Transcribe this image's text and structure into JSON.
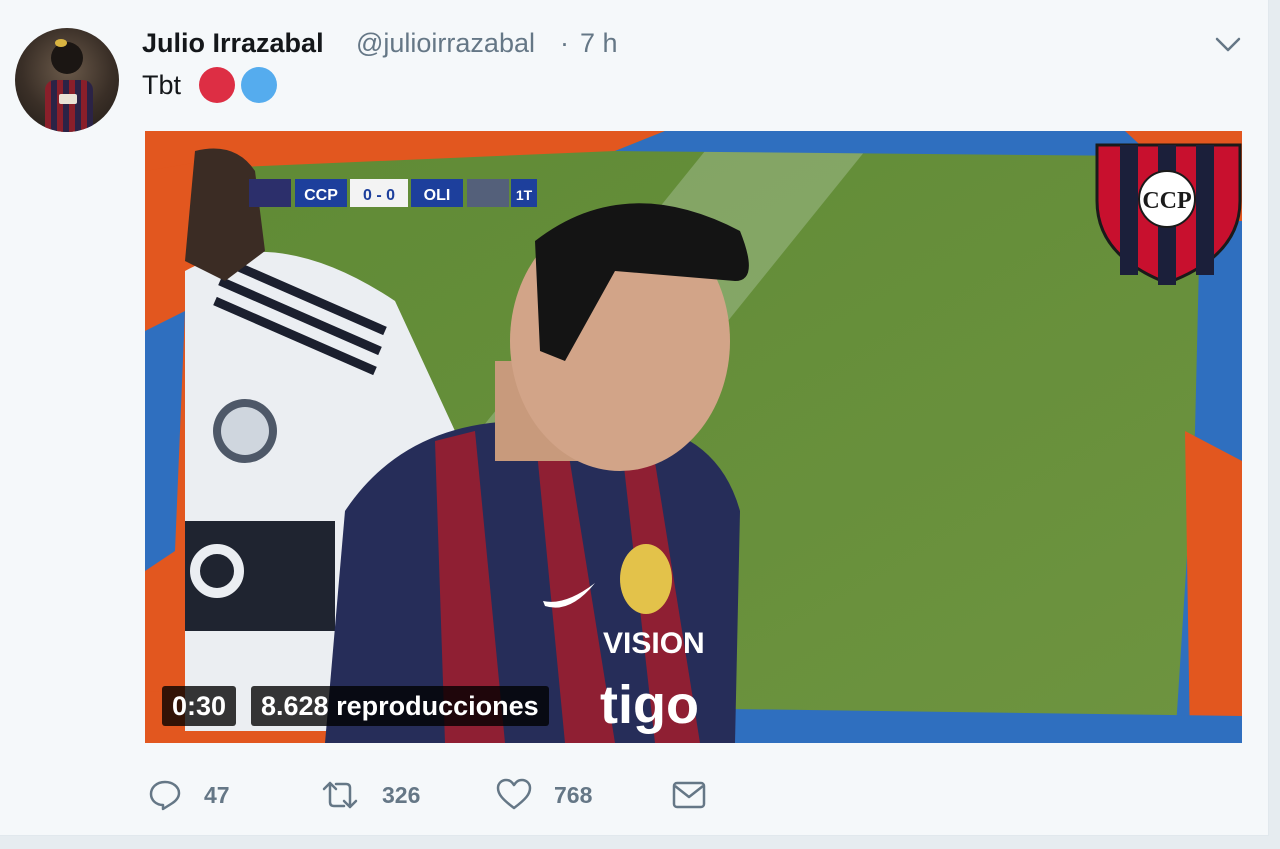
{
  "tweet": {
    "author_name": "Julio Irrazabal",
    "handle": "@julioirrazabal",
    "separator": "·",
    "time": "7 h",
    "text": "Tbt",
    "emojis": [
      "red-circle",
      "blue-circle"
    ]
  },
  "media": {
    "scoreboard": {
      "home": "CCP",
      "score": "0 - 0",
      "away": "OLI",
      "period": "1T"
    },
    "crest_text": "CCP",
    "shirt_sponsor_top": "VISION",
    "shirt_sponsor_bottom": "tigo",
    "duration": "0:30",
    "views": "8.628 reproducciones"
  },
  "actions": {
    "reply_count": "47",
    "retweet_count": "326",
    "like_count": "768"
  },
  "colors": {
    "text_primary": "#14171a",
    "text_secondary": "#657786",
    "background": "#f5f8fa",
    "emoji_red": "#dd2e44",
    "emoji_blue": "#55acee"
  },
  "icons": [
    "chevron-down-icon",
    "reply-icon",
    "retweet-icon",
    "heart-icon",
    "envelope-icon"
  ]
}
